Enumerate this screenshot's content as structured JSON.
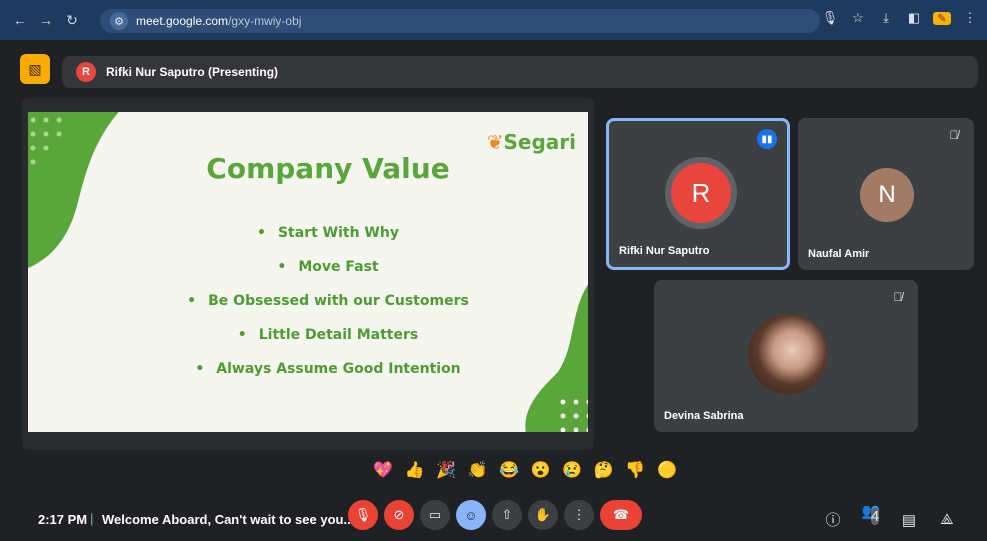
{
  "browser": {
    "url_domain": "meet.google.com",
    "url_path": "/gxy-mwiy-obj",
    "icons": [
      "back-icon",
      "forward-icon",
      "reload-icon",
      "site-settings-icon",
      "mic-icon",
      "star-icon",
      "download-icon",
      "sidepanel-icon",
      "extension-icon",
      "menu-icon"
    ]
  },
  "presenter": {
    "initial": "R",
    "label": "Rifki Nur Saputro (Presenting)"
  },
  "slide": {
    "brand": "Segari",
    "title": "Company Value",
    "values": [
      "Start With Why",
      "Move Fast",
      "Be Obsessed with our Customers",
      "Little Detail Matters",
      "Always Assume Good Intention"
    ],
    "brand_color": "#5aa63b",
    "accent_color": "#f08a24"
  },
  "participants": [
    {
      "name": "Rifki Nur Saputro",
      "initial": "R",
      "avatar_color": "#e8453c",
      "state": "speaking"
    },
    {
      "name": "Naufal Amir",
      "initial": "N",
      "avatar_color": "#a27b67",
      "state": "muted"
    },
    {
      "name": "Devina Sabrina",
      "initial": "",
      "avatar_color": "#6b4c3b",
      "state": "muted"
    }
  ],
  "reactions": [
    "💖",
    "👍",
    "🎉",
    "👏",
    "😂",
    "😮",
    "😢",
    "🤔",
    "👎",
    "🟡"
  ],
  "bottom": {
    "time": "2:17 PM",
    "meeting_title": "Welcome Aboard, Can't wait to see you...",
    "participant_count": "4"
  },
  "colors": {
    "background": "#202124",
    "danger": "#ea4335",
    "active": "#8ab4f8"
  }
}
